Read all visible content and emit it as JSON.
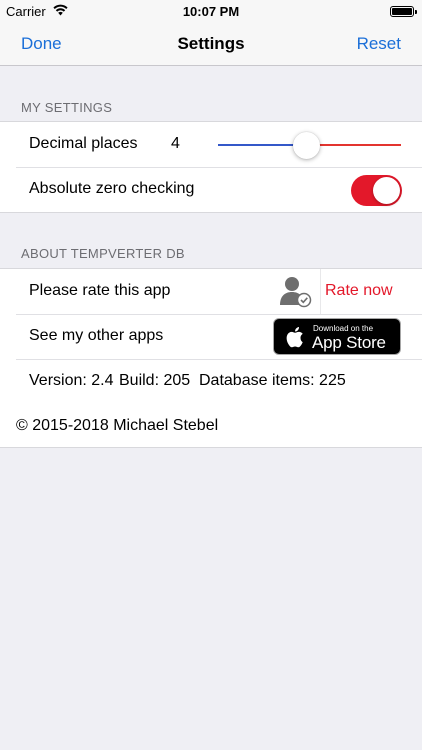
{
  "status_bar": {
    "carrier": "Carrier",
    "time": "10:07 PM"
  },
  "nav": {
    "left": "Done",
    "title": "Settings",
    "right": "Reset"
  },
  "my_settings": {
    "header": "MY SETTINGS",
    "decimal_label": "Decimal places",
    "decimal_value": "4",
    "slider_fraction": 0.48,
    "absolute_zero_label": "Absolute zero checking",
    "absolute_zero_on": true
  },
  "about": {
    "header": "ABOUT TEMPVERTER DB",
    "rate_label": "Please rate this app",
    "rate_action": "Rate now",
    "other_apps_label": "See my other apps",
    "badge_small": "Download on the",
    "badge_big": "App Store",
    "version_text": "Version: 2.4",
    "build_text": "Build: 205",
    "db_text": "Database items: 225"
  },
  "footer": {
    "copyright": "© 2015-2018 Michael Stebel"
  },
  "colors": {
    "accent": "#1b6fd8",
    "red": "#e3182a",
    "slider_min": "#3458c9",
    "slider_max": "#e3342f"
  },
  "icons": [
    "wifi-icon",
    "battery-icon",
    "rate-user-icon",
    "apple-logo-icon"
  ]
}
